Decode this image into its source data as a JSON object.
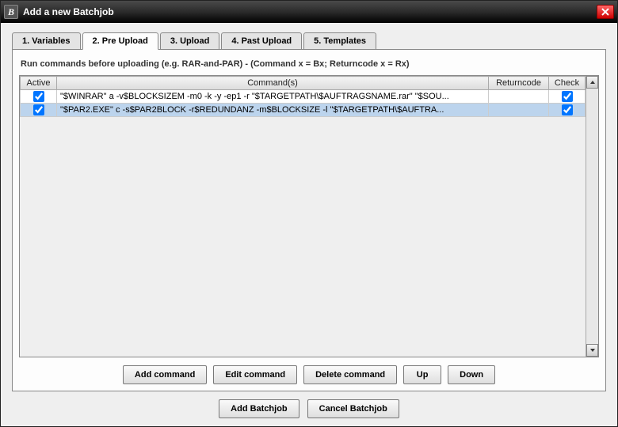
{
  "title": "Add a new Batchjob",
  "tabs": [
    {
      "label": "1. Variables"
    },
    {
      "label": "2. Pre Upload"
    },
    {
      "label": "3. Upload"
    },
    {
      "label": "4. Past Upload"
    },
    {
      "label": "5. Templates"
    }
  ],
  "activeTabIndex": 1,
  "instruction": "Run commands before uploading (e.g. RAR-and-PAR) - (Command x = Bx; Returncode x = Rx)",
  "columns": {
    "active": "Active",
    "command": "Command(s)",
    "returncode": "Returncode",
    "check": "Check"
  },
  "rows": [
    {
      "active": true,
      "command": "\"$WINRAR\" a -v$BLOCKSIZEM -m0 -k -y -ep1 -r \"$TARGETPATH\\$AUFTRAGSNAME.rar\" \"$SOU...",
      "returncode": "",
      "check": true,
      "selected": false
    },
    {
      "active": true,
      "command": "\"$PAR2.EXE\" c -s$PAR2BLOCK -r$REDUNDANZ -m$BLOCKSIZE -l \"$TARGETPATH\\$AUFTRA...",
      "returncode": "",
      "check": true,
      "selected": true
    }
  ],
  "buttons": {
    "add_command": "Add command",
    "edit_command": "Edit command",
    "delete_command": "Delete command",
    "up": "Up",
    "down": "Down",
    "add_batchjob": "Add Batchjob",
    "cancel_batchjob": "Cancel Batchjob"
  }
}
